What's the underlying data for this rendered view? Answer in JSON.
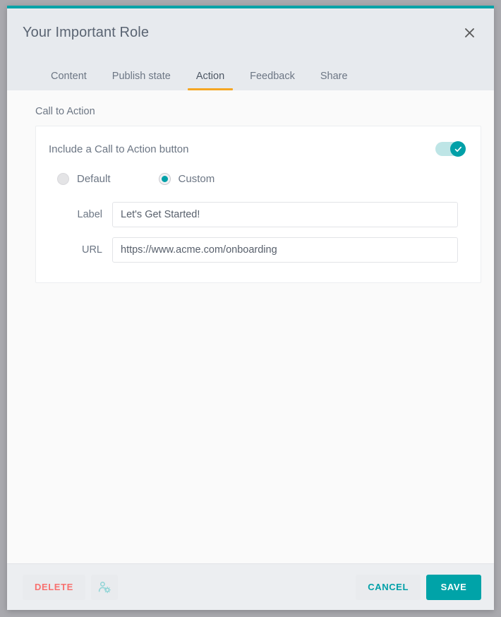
{
  "theme": {
    "accent_teal": "#00a3a8",
    "accent_teal_light": "#bee5e6",
    "tab_active_underline": "#f5a623",
    "delete_red": "#f8716f",
    "header_bg": "#e7eaee",
    "body_bg": "#fafafa",
    "footer_bg": "#eceef1",
    "text_grey": "#6c7684",
    "page_bg": "#a9a9ae"
  },
  "header": {
    "title": "Your Important Role",
    "close_icon": "close-icon"
  },
  "tabs": [
    {
      "label": "Content",
      "active": false
    },
    {
      "label": "Publish state",
      "active": false
    },
    {
      "label": "Action",
      "active": true
    },
    {
      "label": "Feedback",
      "active": false
    },
    {
      "label": "Share",
      "active": false
    }
  ],
  "main": {
    "section_heading": "Call to Action",
    "toggle": {
      "label": "Include a Call to Action button",
      "state": "on",
      "knob_icon": "check-icon"
    },
    "radio_group": {
      "options": [
        {
          "label": "Default",
          "selected": false
        },
        {
          "label": "Custom",
          "selected": true
        }
      ]
    },
    "fields": [
      {
        "label": "Label",
        "value": "Let's Get Started!",
        "placeholder": "Button label"
      },
      {
        "label": "URL",
        "value": "https://www.acme.com/onboarding",
        "placeholder": "https://"
      }
    ]
  },
  "footer": {
    "delete_label": "DELETE",
    "permissions_icon": "user-settings-icon",
    "cancel_label": "CANCEL",
    "save_label": "SAVE"
  }
}
